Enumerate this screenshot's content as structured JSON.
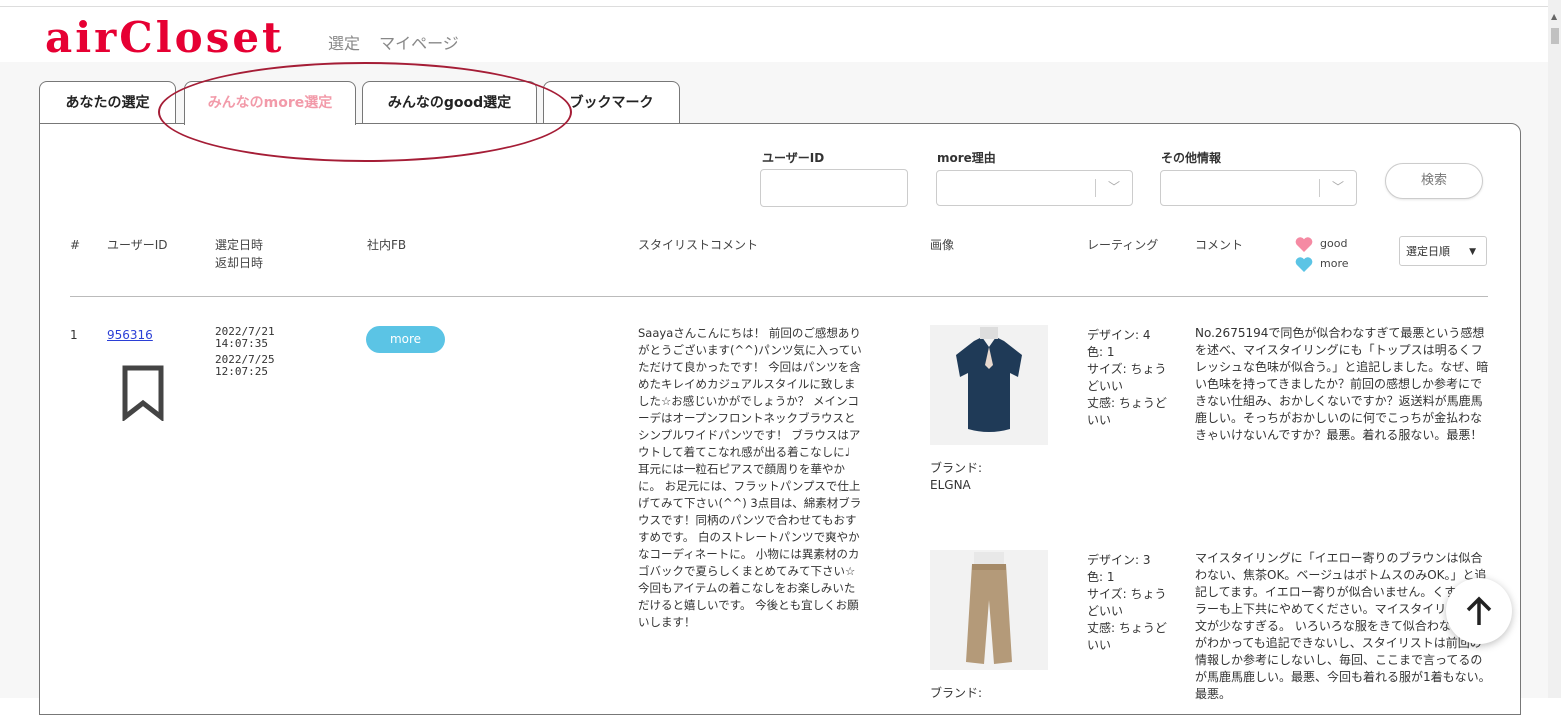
{
  "app": {
    "logo": "airCloset",
    "nav": [
      "選定",
      "マイページ"
    ]
  },
  "tabs": [
    {
      "label": "あなたの選定"
    },
    {
      "label": "みんなのmore選定",
      "active": true
    },
    {
      "label": "みんなのgood選定"
    },
    {
      "label": "ブックマーク"
    }
  ],
  "filters": {
    "user_id_label": "ユーザーID",
    "reason_label": "more理由",
    "other_label": "その他情報",
    "search_button": "検索"
  },
  "table": {
    "headers": {
      "num": "#",
      "user_id": "ユーザーID",
      "dates_line1": "選定日時",
      "dates_line2": "返却日時",
      "internal_fb": "社内FB",
      "stylist_comment": "スタイリストコメント",
      "image": "画像",
      "rating": "レーティング",
      "comment": "コメント"
    },
    "legend": {
      "good": "good",
      "more": "more"
    },
    "sort": "選定日順",
    "rows": [
      {
        "num": "1",
        "user_id": "956316",
        "selected_at": "2022/7/21 14:07:35",
        "returned_at": "2022/7/25 12:07:25",
        "fb": "more",
        "stylist_comment": "Saayaさんこんにちは！ 前回のご感想ありがとうございます(^^)パンツ気に入っていただけて良かったです！ 今回はパンツを含めたキレイめカジュアルスタイルに致しました☆お感じいかがでしょうか？ メインコーデはオープンフロントネックブラウスとシンプルワイドパンツです！ ブラウスはアウトして着てこなれ感が出る着こなしに♩ 耳元には一粒石ピアスで顔周りを華やかに。 お足元には、フラットパンプスで仕上げてみて下さい(^^) 3点目は、綿素材ブラウスです！同柄のパンツで合わせてもおすすめです。 白のストレートパンツで爽やかなコーディネートに。 小物には異素材のカゴバックで夏らしくまとめてみて下さい☆ 今回もアイテムの着こなしをお楽しみいただけると嬉しいです。 今後とも宜しくお願いします！",
        "items": [
          {
            "brand_label": "ブランド:",
            "brand": "ELGNA",
            "rating": [
              "デザイン: 4",
              "色: 1",
              "サイズ: ちょうどいい",
              "丈感: ちょうどいい"
            ],
            "comment": "No.2675194で同色が似合わなすぎて最悪という感想を述べ、マイスタイリングにも「トップスは明るくフレッシュな色味が似合う。」と追記しました。なぜ、暗い色味を持ってきましたか？前回の感想しか参考にできない仕組み、おかしくないですか？返送料が馬鹿馬鹿しい。そっちがおかしいのに何でこっちが金払わなきゃいけないんですか？最悪。着れる服ない。最悪！"
          },
          {
            "brand_label": "ブランド:",
            "rating": [
              "デザイン: 3",
              "色: 1",
              "サイズ: ちょうどいい",
              "丈感: ちょうどいい"
            ],
            "comment": "マイスタイリングに「イエロー寄りのブラウンは似合わない、焦茶OK。ベージュはボトムスのみOK。」と追記してます。イエロー寄りが似合いません。くすみカラーも上下共にやめてください。マイスタイリングの文が少なすぎる。 いろいろな服をきて似合わないものがわかっても追記できないし、スタイリストは前回の情報しか参考にしないし、毎回、ここまで言ってるのが馬鹿馬鹿しい。最悪、今回も着れる服が1着もない。最悪。"
          }
        ]
      }
    ]
  },
  "colors": {
    "brand": "#e60033",
    "active_tab": "#f29aa9",
    "more": "#5bc4e5",
    "good": "#f58aa3",
    "oval": "#a51d36"
  }
}
